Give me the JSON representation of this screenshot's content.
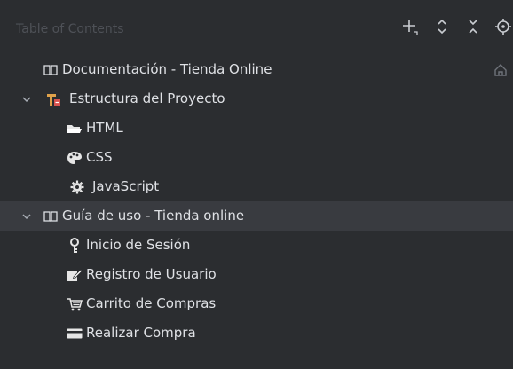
{
  "header": {
    "title": "Table of Contents",
    "add_icon": "add-icon",
    "expand_icon": "expand-all-icon",
    "collapse_icon": "collapse-all-icon",
    "locate_icon": "locate-icon"
  },
  "tree": {
    "items": [
      {
        "label": "Documentación - Tienda Online",
        "icon": "book-icon",
        "expanded": null,
        "selected": false
      },
      {
        "label": "Estructura del Proyecto",
        "icon": "project-structure-icon",
        "expanded": true,
        "selected": false
      },
      {
        "label": "HTML",
        "icon": "folder-icon",
        "expanded": null,
        "selected": false
      },
      {
        "label": "CSS",
        "icon": "palette-icon",
        "expanded": null,
        "selected": false
      },
      {
        "label": "JavaScript",
        "icon": "gear-icon",
        "expanded": null,
        "selected": false
      },
      {
        "label": "Guía de uso - Tienda online",
        "icon": "book-icon",
        "expanded": true,
        "selected": true
      },
      {
        "label": "Inicio de Sesión",
        "icon": "key-icon",
        "expanded": null,
        "selected": false
      },
      {
        "label": "Registro de Usuario",
        "icon": "edit-icon",
        "expanded": null,
        "selected": false
      },
      {
        "label": "Carrito de Compras",
        "icon": "cart-icon",
        "expanded": null,
        "selected": false
      },
      {
        "label": "Realizar Compra",
        "icon": "credit-card-icon",
        "expanded": null,
        "selected": false
      }
    ]
  },
  "colors": {
    "background": "#2b2d30",
    "selected_row": "#393b40",
    "text": "#dfe1e5",
    "muted_text": "#4e5157",
    "icon_gray": "#a8adb5"
  }
}
